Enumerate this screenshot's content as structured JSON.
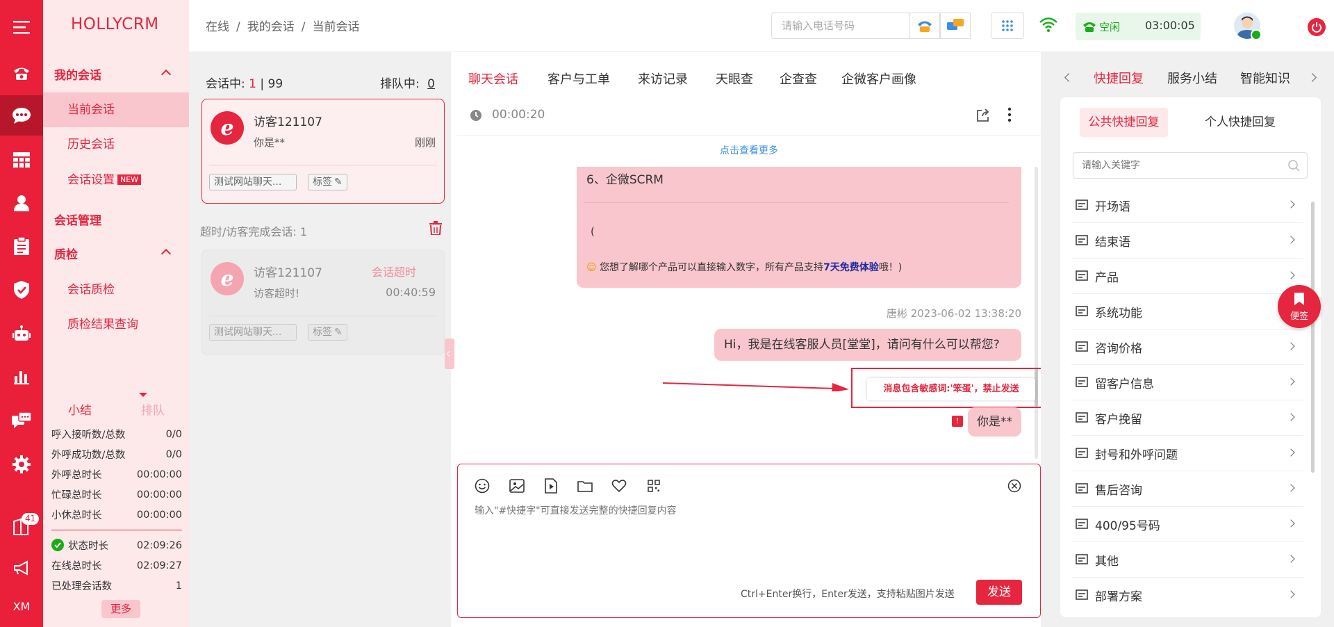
{
  "brand": "HOLLYCRM",
  "rail": {
    "badge_count": "41",
    "bottom_label": "XM"
  },
  "nav": {
    "my_sessions": "我的会话",
    "current_session": "当前会话",
    "history_session": "历史会话",
    "session_settings": "会话设置",
    "new_badge": "NEW",
    "session_management": "会话管理",
    "quality_check": "质检",
    "session_qc": "会话质检",
    "qc_result": "质检结果查询"
  },
  "summary": {
    "tab_summary": "小结",
    "tab_queue": "排队",
    "rows": [
      {
        "label": "呼入接听数/总数",
        "value": "0/0"
      },
      {
        "label": "外呼成功数/总数",
        "value": "0/0"
      },
      {
        "label": "外呼总时长",
        "value": "00:00:00"
      },
      {
        "label": "忙碌总时长",
        "value": "00:00:00"
      },
      {
        "label": "小休总时长",
        "value": "00:00:00"
      }
    ],
    "rows2": [
      {
        "label": "状态时长",
        "value": "02:09:26"
      },
      {
        "label": "在线总时长",
        "value": "02:09:27"
      },
      {
        "label": "已处理会话数",
        "value": "1"
      }
    ],
    "more": "更多"
  },
  "breadcrumb": {
    "a": "在线",
    "sep": "/",
    "b": "我的会话",
    "c": "当前会话"
  },
  "topbar": {
    "phone_placeholder": "请输入电话号码",
    "status_label": "空闲",
    "timer": "03:00:05"
  },
  "convlist": {
    "in_session_label": "会话中:",
    "in_session_count": "1",
    "in_session_total": "| 99",
    "queue_label": "排队中:",
    "queue_count": "0",
    "active_card": {
      "name": "访客121107",
      "msg": "你是**",
      "time": "刚刚",
      "source": "测试网站聊天...",
      "tag": "标签"
    },
    "timeout_header": "超时/访客完成会话: 1",
    "timeout_card": {
      "name": "访客121107",
      "status": "会话超时",
      "msg": "访客超时!",
      "time": "00:40:59",
      "source": "测试网站聊天...",
      "tag": "标签"
    }
  },
  "chat": {
    "tabs": [
      "聊天会话",
      "客户与工单",
      "来访记录",
      "天眼查",
      "企查查",
      "企微客户画像"
    ],
    "duration": "00:00:20",
    "load_more": "点击查看更多",
    "prev_bubble_line": "6、企微SCRM",
    "prev_bubble_paren": "(",
    "prev_bubble_footer_a": "您想了解哪个产品可以直接输入数字，所有产品支持",
    "prev_bubble_footer_b": "7天免费体验",
    "prev_bubble_footer_c": "哦！)",
    "sender_time": "唐彬 2023-06-02 13:38:20",
    "greeting": "Hi，我是在线客服人员[堂堂]，请问有什么可以帮您?",
    "warning": "消息包含敏感词:'笨蛋'，禁止发送",
    "failed_msg": "你是**",
    "input_placeholder": "输入\"#快捷字\"可直接发送完整的快捷回复内容",
    "send_hint": "Ctrl+Enter换行，Enter发送，支持粘贴图片发送",
    "send_button": "发送"
  },
  "right": {
    "tabs": [
      "快捷回复",
      "服务小结",
      "智能知识"
    ],
    "public_quick": "公共快捷回复",
    "personal_quick": "个人快捷回复",
    "search_placeholder": "请输入关键字",
    "items": [
      "开场语",
      "结束语",
      "产品",
      "系统功能",
      "咨询价格",
      "留客户信息",
      "客户挽留",
      "封号和外呼问题",
      "售后咨询",
      "400/95号码",
      "其他",
      "部署方案"
    ],
    "sticky_label": "便签"
  },
  "colors": {
    "brand_red": "#ea1f3a",
    "pink_bg": "#fde8ea",
    "bubble_pink": "#f9c6cd",
    "status_green": "#1aad19"
  }
}
